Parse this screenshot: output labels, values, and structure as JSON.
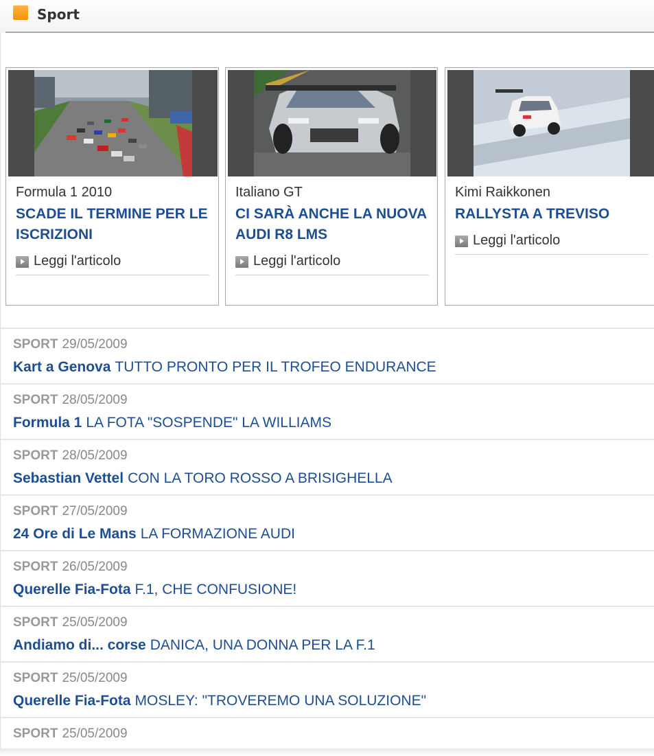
{
  "section": {
    "title": "Sport",
    "accent_color": "#f39200"
  },
  "cards": [
    {
      "category": "Formula 1 2010",
      "headline": "SCADE IL TERMINE PER LE ISCRIZIONI",
      "read_more": "Leggi l'articolo",
      "image": "formula-1-race-start-photo"
    },
    {
      "category": "Italiano GT",
      "headline": "CI SARÀ ANCHE LA NUOVA AUDI R8 LMS",
      "read_more": "Leggi l'articolo",
      "image": "audi-r8-lms-race-car-photo"
    },
    {
      "category": "Kimi Raikkonen",
      "headline": "RALLYSTA A TREVISO",
      "read_more": "Leggi l'articolo",
      "image": "rally-car-on-snow-photo"
    }
  ],
  "news": [
    {
      "section": "SPORT",
      "date": "29/05/2009",
      "kicker": "Kart a Genova",
      "headline": "TUTTO PRONTO PER IL TROFEO ENDURANCE"
    },
    {
      "section": "SPORT",
      "date": "28/05/2009",
      "kicker": "Formula 1",
      "headline": "LA FOTA \"SOSPENDE\" LA WILLIAMS"
    },
    {
      "section": "SPORT",
      "date": "28/05/2009",
      "kicker": "Sebastian Vettel",
      "headline": "CON LA TORO ROSSO A BRISIGHELLA"
    },
    {
      "section": "SPORT",
      "date": "27/05/2009",
      "kicker": "24 Ore di Le Mans",
      "headline": "LA FORMAZIONE AUDI"
    },
    {
      "section": "SPORT",
      "date": "26/05/2009",
      "kicker": "Querelle Fia-Fota",
      "headline": "F.1, CHE CONFUSIONE!"
    },
    {
      "section": "SPORT",
      "date": "25/05/2009",
      "kicker": "Andiamo di... corse",
      "headline": "DANICA, UNA DONNA PER LA F.1"
    },
    {
      "section": "SPORT",
      "date": "25/05/2009",
      "kicker": "Querelle Fia-Fota",
      "headline": "MOSLEY: \"TROVEREMO UNA SOLUZIONE\""
    },
    {
      "section": "SPORT",
      "date": "25/05/2009",
      "kicker": "",
      "headline": ""
    }
  ],
  "colors": {
    "link": "#1d4e93",
    "meta": "#888888",
    "border": "#a8a8a8"
  }
}
